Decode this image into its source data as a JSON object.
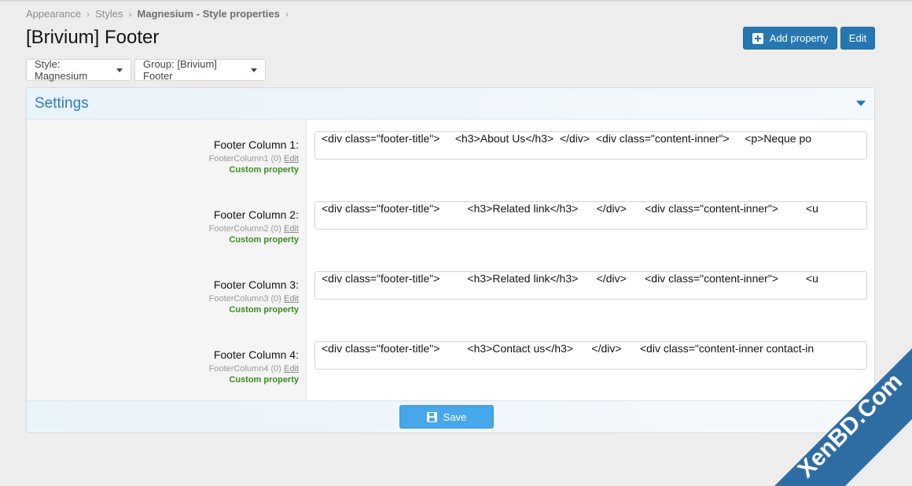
{
  "breadcrumb": {
    "items": [
      "Appearance",
      "Styles",
      "Magnesium - Style properties"
    ]
  },
  "page": {
    "title": "[Brivium] Footer"
  },
  "actions": {
    "add_property": "Add property",
    "edit": "Edit"
  },
  "filters": {
    "style": "Style: Magnesium",
    "group": "Group: [Brivium] Footer"
  },
  "panel": {
    "title": "Settings",
    "rows": [
      {
        "title": "Footer Column 1:",
        "meta": "FooterColumn1 (0)",
        "edit_label": "Edit",
        "custom": "Custom property",
        "value": "<div class=\"footer-title\">     <h3>About Us</h3>  </div>  <div class=\"content-inner\">     <p>Neque po"
      },
      {
        "title": "Footer Column 2:",
        "meta": "FooterColumn2 (0)",
        "edit_label": "Edit",
        "custom": "Custom property",
        "value": "<div class=\"footer-title\">         <h3>Related link</h3>      </div>      <div class=\"content-inner\">         <u"
      },
      {
        "title": "Footer Column 3:",
        "meta": "FooterColumn3 (0)",
        "edit_label": "Edit",
        "custom": "Custom property",
        "value": "<div class=\"footer-title\">         <h3>Related link</h3>      </div>      <div class=\"content-inner\">         <u"
      },
      {
        "title": "Footer Column 4:",
        "meta": "FooterColumn4 (0)",
        "edit_label": "Edit",
        "custom": "Custom property",
        "value": "<div class=\"footer-title\">         <h3>Contact us</h3>      </div>      <div class=\"content-inner contact-in"
      }
    ],
    "save": "Save"
  },
  "watermark": {
    "text": "XenBD.Com",
    "color": "#2e6da4"
  }
}
